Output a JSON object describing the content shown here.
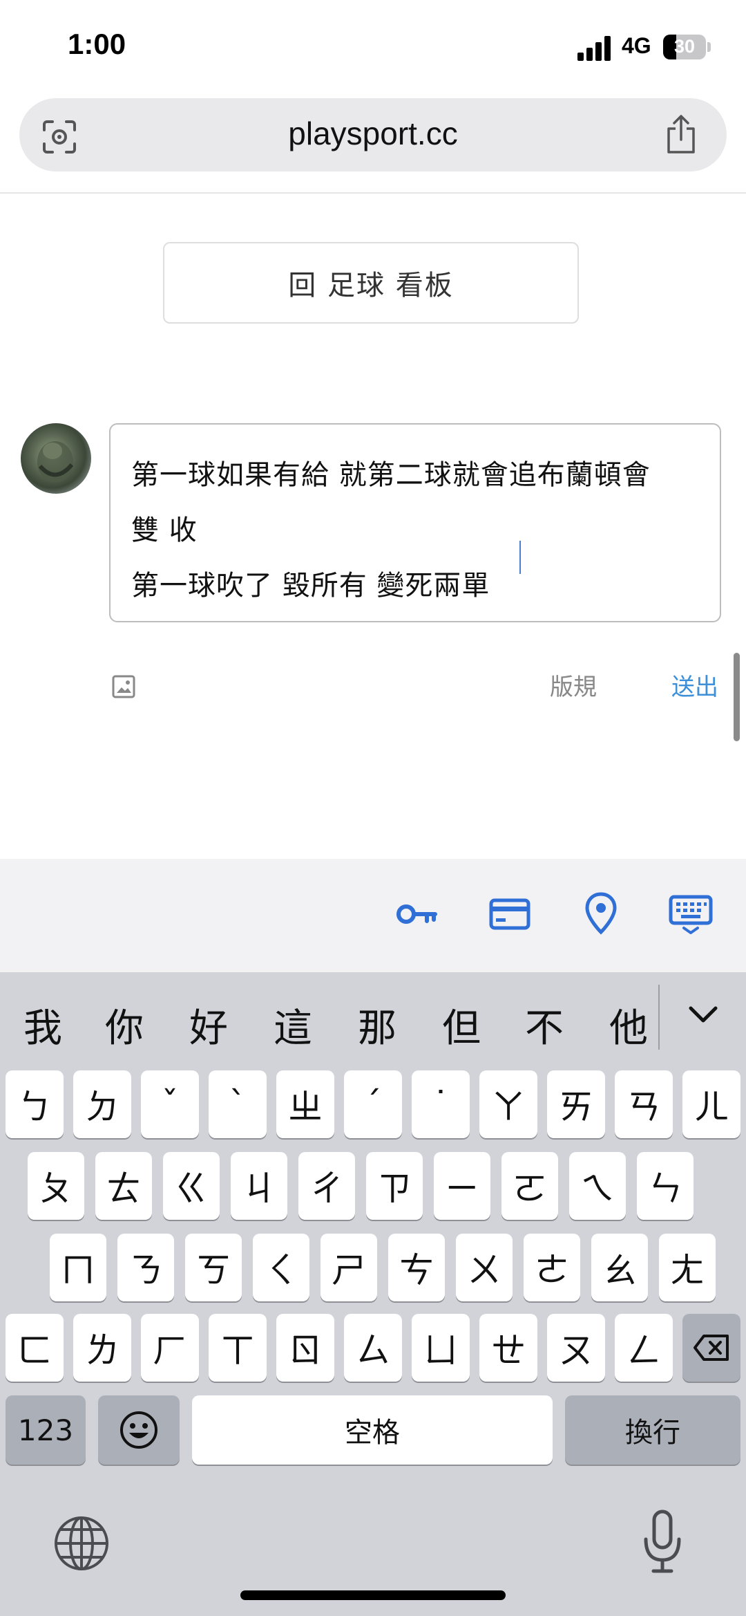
{
  "status_bar": {
    "time": "1:00",
    "network": "4G",
    "battery": "30",
    "battery_level": 0.3
  },
  "browser": {
    "url": "playsport.cc"
  },
  "back_button": {
    "label": "回 足球 看板"
  },
  "composer": {
    "lines": [
      "第一球如果有給 就第二球就會追布蘭頓會",
      "雙 收",
      "第一球吹了 毀所有 變死兩單"
    ],
    "rules_label": "版規",
    "submit_label": "送出"
  },
  "keyboard": {
    "candidates": [
      "我",
      "你",
      "好",
      "這",
      "那",
      "但",
      "不",
      "他"
    ],
    "row1": [
      "ㄅ",
      "ㄉ",
      "ˇ",
      "ˋ",
      "ㄓ",
      "ˊ",
      "˙",
      "ㄚ",
      "ㄞ",
      "ㄢ",
      "ㄦ"
    ],
    "row2": [
      "ㄆ",
      "ㄊ",
      "ㄍ",
      "ㄐ",
      "ㄔ",
      "ㄗ",
      "ㄧ",
      "ㄛ",
      "ㄟ",
      "ㄣ"
    ],
    "row3": [
      "ㄇ",
      "ㄋ",
      "ㄎ",
      "ㄑ",
      "ㄕ",
      "ㄘ",
      "ㄨ",
      "ㄜ",
      "ㄠ",
      "ㄤ"
    ],
    "row4": [
      "ㄈ",
      "ㄌ",
      "ㄏ",
      "ㄒ",
      "ㄖ",
      "ㄙ",
      "ㄩ",
      "ㄝ",
      "ㄡ",
      "ㄥ"
    ],
    "numbers_label": "123",
    "space_label": "空格",
    "return_label": "換行"
  }
}
